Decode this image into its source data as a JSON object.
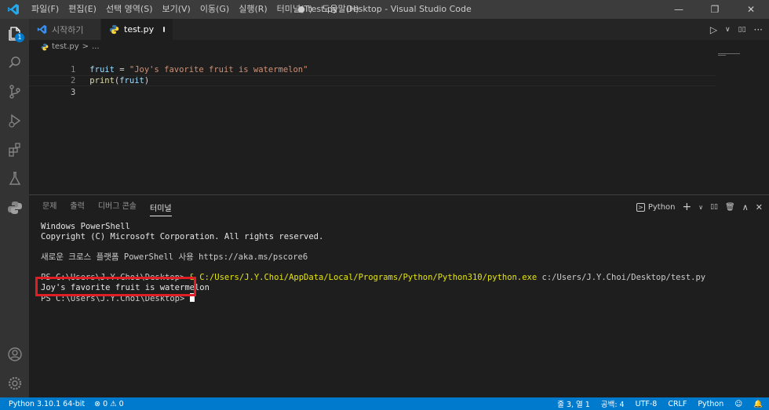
{
  "titlebar": {
    "menu": [
      "파일(F)",
      "편집(E)",
      "선택 영역(S)",
      "보기(V)",
      "이동(G)",
      "실행(R)",
      "터미널(T)",
      "도움말(H)"
    ],
    "window_title": "● test.py - Desktop - Visual Studio Code",
    "minimize": "—",
    "restore": "❐",
    "close": "✕"
  },
  "activitybar": {
    "explorer_badge": "1"
  },
  "tabs": [
    {
      "label": "시작하기"
    },
    {
      "label": "test.py"
    }
  ],
  "editor_actions": {
    "run": "▷",
    "run_menu": "∨",
    "split": "▯▯",
    "more": "···"
  },
  "breadcrumb": {
    "file": "test.py",
    "sep": ">",
    "rest": "..."
  },
  "code": {
    "lines": [
      {
        "num": "1",
        "var": "fruit",
        "op": " = ",
        "str": "\"Joy's favorite fruit is watermelon\""
      },
      {
        "num": "2",
        "fn": "print",
        "open": "(",
        "arg": "fruit",
        "close": ")"
      },
      {
        "num": "3"
      }
    ]
  },
  "panel": {
    "tabs": [
      "문제",
      "출력",
      "디버그 콘솔",
      "터미널"
    ],
    "terminal_name": "Python",
    "add": "+",
    "add_menu": "∨",
    "split": "▯▯",
    "trash": "🗑",
    "maximize": "∧",
    "close": "✕"
  },
  "terminal": {
    "line1": "Windows PowerShell",
    "line2": "Copyright (C) Microsoft Corporation. All rights reserved.",
    "line3": "새로운 크로스 플랫폼 PowerShell 사용 https://aka.ms/pscore6",
    "line4_prompt": "PS C:\\Users\\J.Y.Choi\\Desktop> ",
    "line4_cmd": "& C:/Users/J.Y.Choi/AppData/Local/Programs/Python/Python310/python.exe",
    "line4_arg": " c:/Users/J.Y.Choi/Desktop/test.py",
    "line5": "Joy's favorite fruit is watermelon",
    "line6_prompt": "PS C:\\Users\\J.Y.Choi\\Desktop> "
  },
  "statusbar": {
    "python": "Python 3.10.1 64-bit",
    "errors": "0",
    "warnings": "0",
    "position": "줄 3, 열 1",
    "spaces": "공백: 4",
    "encoding": "UTF-8",
    "eol": "CRLF",
    "language": "Python"
  },
  "colors": {
    "accent": "#007acc",
    "highlight_box": "#e01e26"
  }
}
